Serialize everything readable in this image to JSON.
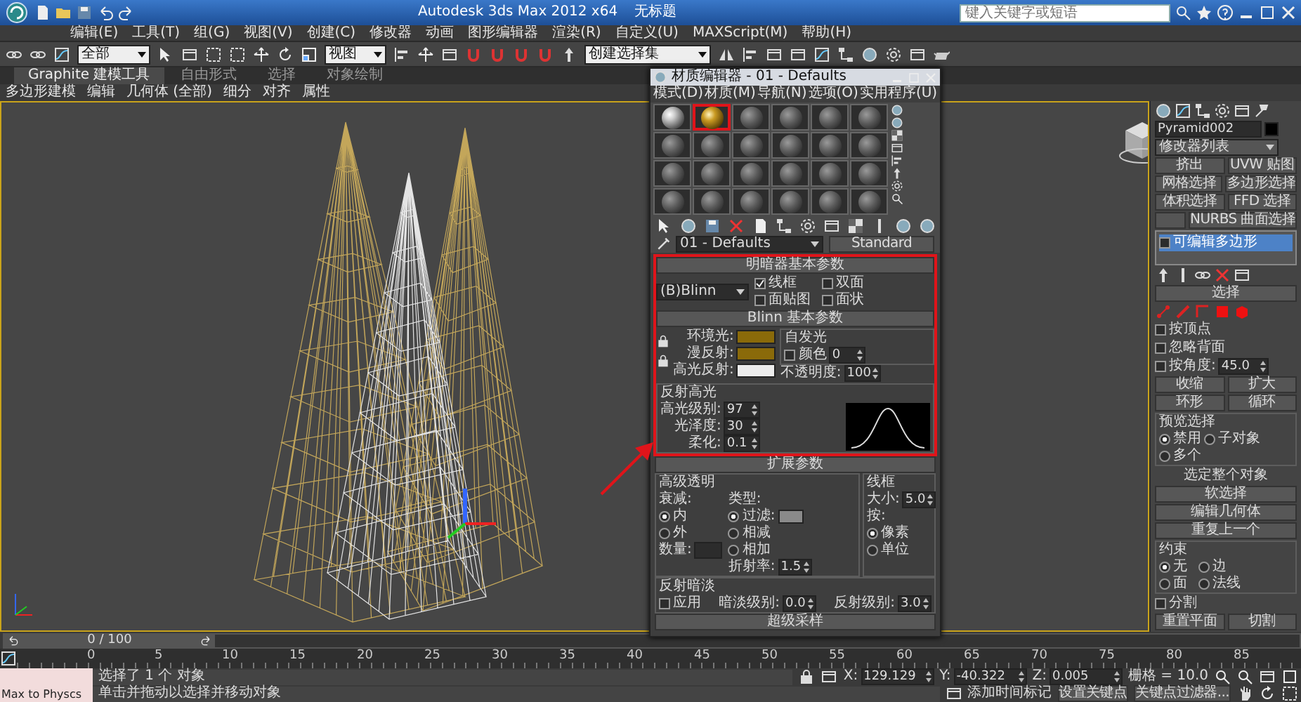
{
  "title_bar": {
    "title": "Autodesk 3ds Max  2012 x64",
    "document": "无标题",
    "search": {
      "placeholder": "键入关键字或短语"
    }
  },
  "menu_bar": [
    "编辑(E)",
    "工具(T)",
    "组(G)",
    "视图(V)",
    "创建(C)",
    "修改器",
    "动画",
    "图形编辑器",
    "渲染(R)",
    "自定义(U)",
    "MAXScript(M)",
    "帮助(H)"
  ],
  "toolbar": {
    "selection_filter": "全部",
    "reference_coord": "视图",
    "named_selection": "创建选择集"
  },
  "ribbon": {
    "tabs": [
      {
        "label": "Graphite 建模工具",
        "selected": true
      },
      {
        "label": "自由形式",
        "selected": false
      },
      {
        "label": "选择",
        "selected": false
      },
      {
        "label": "对象绘制",
        "selected": false
      }
    ],
    "groups": [
      "多边形建模",
      "编辑",
      "几何体 (全部)",
      "细分",
      "对齐",
      "属性"
    ]
  },
  "material_editor": {
    "title": "材质编辑器 - 01 - Defaults",
    "menu": [
      "模式(D)",
      "材质(M)",
      "导航(N)",
      "选项(O)",
      "实用程序(U)"
    ],
    "slots": [
      {
        "kind": "white",
        "selected": false
      },
      {
        "kind": "gold",
        "selected": true
      },
      {
        "kind": "grey",
        "selected": false
      },
      {
        "kind": "grey",
        "selected": false
      },
      {
        "kind": "grey",
        "selected": false
      },
      {
        "kind": "grey",
        "selected": false
      },
      {
        "kind": "grey",
        "selected": false
      },
      {
        "kind": "grey",
        "selected": false
      },
      {
        "kind": "grey",
        "selected": false
      },
      {
        "kind": "grey",
        "selected": false
      },
      {
        "kind": "grey",
        "selected": false
      },
      {
        "kind": "grey",
        "selected": false
      },
      {
        "kind": "grey",
        "selected": false
      },
      {
        "kind": "grey",
        "selected": false
      },
      {
        "kind": "grey",
        "selected": false
      },
      {
        "kind": "grey",
        "selected": false
      },
      {
        "kind": "grey",
        "selected": false
      },
      {
        "kind": "grey",
        "selected": false
      },
      {
        "kind": "grey",
        "selected": false
      },
      {
        "kind": "grey",
        "selected": false
      },
      {
        "kind": "grey",
        "selected": false
      },
      {
        "kind": "grey",
        "selected": false
      },
      {
        "kind": "grey",
        "selected": false
      },
      {
        "kind": "grey",
        "selected": false
      }
    ],
    "material_name": "01 - Defaults",
    "material_type": "Standard",
    "shader_basic": {
      "title": "明暗器基本参数",
      "shader": "(B)Blinn",
      "options": [
        {
          "label": "线框",
          "checked": true
        },
        {
          "label": "双面",
          "checked": false
        },
        {
          "label": "面贴图",
          "checked": false
        },
        {
          "label": "面状",
          "checked": false
        }
      ]
    },
    "blinn_basic": {
      "title": "Blinn 基本参数",
      "colors": [
        {
          "label": "环境光:",
          "color": "#8a6a0a"
        },
        {
          "label": "漫反射:",
          "color": "#8a6a0a"
        },
        {
          "label": "高光反射:",
          "color": "#ececec"
        }
      ],
      "self_illum": {
        "title": "自发光",
        "label": "颜色",
        "checked": false,
        "value": "0"
      },
      "opacity": {
        "label": "不透明度:",
        "value": "100"
      },
      "specular": {
        "title": "反射高光",
        "fields": [
          {
            "label": "高光级别:",
            "value": "97"
          },
          {
            "label": "光泽度:",
            "value": "30"
          },
          {
            "label": "柔化:",
            "value": "0.1"
          }
        ]
      }
    },
    "extended": {
      "title": "扩展参数",
      "adv_title": "高级透明",
      "falloff": {
        "label": "衰减:",
        "options": [
          {
            "label": "内",
            "selected": true
          },
          {
            "label": "外",
            "selected": false
          }
        ]
      },
      "type": {
        "label": "类型:",
        "options": [
          {
            "label": "过滤:",
            "selected": true
          },
          {
            "label": "相减",
            "selected": false
          },
          {
            "label": "相加",
            "selected": false
          }
        ]
      },
      "amount": {
        "label": "数量:"
      },
      "ior": {
        "label": "折射率:",
        "value": "1.5"
      },
      "wire": {
        "title": "线框",
        "size_label": "大小:",
        "size": "5.0",
        "by_label": "按:",
        "options": [
          {
            "label": "像素",
            "selected": true
          },
          {
            "label": "单位",
            "selected": false
          }
        ]
      },
      "dim": {
        "title": "反射暗淡",
        "apply": {
          "label": "应用",
          "checked": false
        },
        "fields": [
          {
            "label": "暗淡级别:",
            "value": "0.0"
          },
          {
            "label": "反射级别:",
            "value": "3.0"
          }
        ]
      }
    },
    "supersampling": "超级采样"
  },
  "command_panel": {
    "object_name": "Pyramid002",
    "modifier_list": "修改器列表",
    "modifier_rows": [
      [
        "挤出",
        "UVW 贴图"
      ],
      [
        "网格选择",
        "多边形选择"
      ],
      [
        "体积选择",
        "FFD 选择"
      ],
      [
        "NURBS 曲面选择"
      ]
    ],
    "stack": [
      {
        "label": "可编辑多边形",
        "selected": true
      }
    ],
    "selection": {
      "title": "选择",
      "options": [
        {
          "label": "按顶点",
          "checked": false
        },
        {
          "label": "忽略背面",
          "checked": false
        },
        {
          "label": "按角度:",
          "checked": false,
          "value": "45.0"
        }
      ],
      "button_rows": [
        [
          "收缩",
          "扩大"
        ],
        [
          "环形",
          "循环"
        ]
      ],
      "preview": {
        "title": "预览选择",
        "options": [
          {
            "label": "禁用",
            "selected": true
          },
          {
            "label": "子对象",
            "selected": false
          },
          {
            "label": "多个",
            "selected": false
          }
        ]
      },
      "status": "选定整个对象"
    },
    "soft_selection": "软选择",
    "edit_geometry": {
      "title": "编辑几何体",
      "repeat": "重复上一个",
      "constraint": {
        "title": "约束",
        "options": [
          {
            "label": "无",
            "selected": true
          },
          {
            "label": "边",
            "selected": false
          },
          {
            "label": "面",
            "selected": false
          },
          {
            "label": "法线",
            "selected": false
          }
        ]
      },
      "split": {
        "label": "分割",
        "checked": false
      },
      "buttons": [
        "重置平面",
        "切割"
      ]
    }
  },
  "timeline": {
    "frame": "0 / 100",
    "ticks": [
      "0",
      "5",
      "10",
      "15",
      "20",
      "25",
      "30",
      "35",
      "40",
      "45",
      "50",
      "55",
      "60",
      "65",
      "70",
      "75",
      "80",
      "85"
    ]
  },
  "status": {
    "script_box": "Max to Physcs",
    "selection": "选择了 1 个 对象",
    "prompt": "单击并拖动以选择并移动对象",
    "coords": [
      {
        "axis": "X:",
        "value": "129.129"
      },
      {
        "axis": "Y:",
        "value": "-40.322"
      },
      {
        "axis": "Z:",
        "value": "0.005"
      }
    ],
    "grid": "栅格 = 10.0",
    "time_tag": "添加时间标记",
    "set_key": "设置关键点",
    "key_filter": "关键点过滤器..."
  }
}
